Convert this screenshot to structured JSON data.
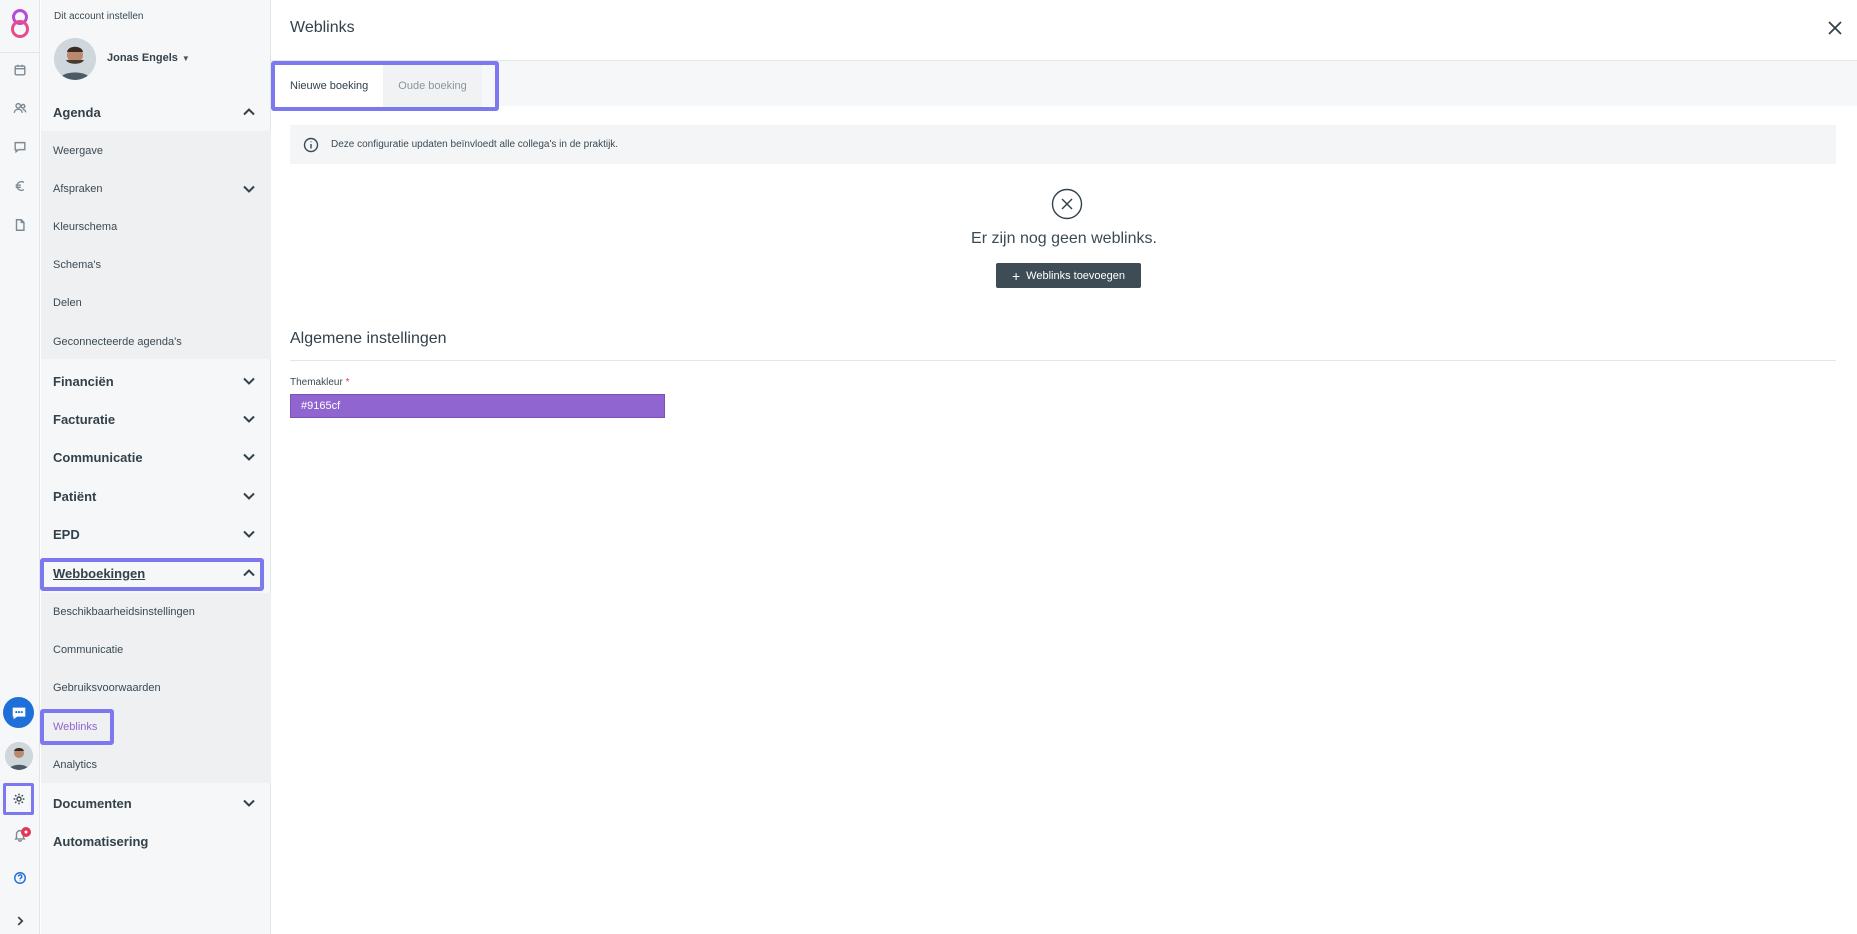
{
  "account": {
    "setup_label": "Dit account instellen",
    "user_name": "Jonas Engels"
  },
  "sidebar": {
    "agenda": {
      "label": "Agenda",
      "items": [
        "Weergave",
        "Afspraken",
        "Kleurschema",
        "Schema's",
        "Delen",
        "Geconnecteerde agenda's"
      ]
    },
    "sections": [
      "Financiën",
      "Facturatie",
      "Communicatie",
      "Patiënt",
      "EPD"
    ],
    "webboekingen": {
      "label": "Webboekingen",
      "items": [
        "Beschikbaarheidsinstellingen",
        "Communicatie",
        "Gebruiksvoorwaarden",
        "Weblinks",
        "Analytics"
      ],
      "active_item": "Weblinks"
    },
    "documenten": "Documenten",
    "automatisering": "Automatisering"
  },
  "main": {
    "title": "Weblinks",
    "tabs": [
      {
        "label": "Nieuwe boeking",
        "active": true
      },
      {
        "label": "Oude boeking",
        "active": false
      }
    ],
    "info_text": "Deze configuratie updaten beïnvloedt alle collega's in de praktijk.",
    "empty_text": "Er zijn nog geen weblinks.",
    "add_button": "Weblinks toevoegen",
    "section_title": "Algemene instellingen",
    "theme_label": "Themakleur",
    "theme_required": "*",
    "theme_value": "#9165cf"
  },
  "colors": {
    "accent_highlight": "#7b78f0",
    "theme": "#9165cf",
    "active_link": "#9165cf",
    "chat": "#1f6fd8",
    "notification": "#e4365b"
  },
  "icons": {
    "rail": [
      "calendar-icon",
      "users-icon",
      "message-icon",
      "euro-icon",
      "document-icon",
      "chat-icon",
      "avatar",
      "gear-icon",
      "bell-icon",
      "help-icon",
      "expand-icon"
    ]
  }
}
